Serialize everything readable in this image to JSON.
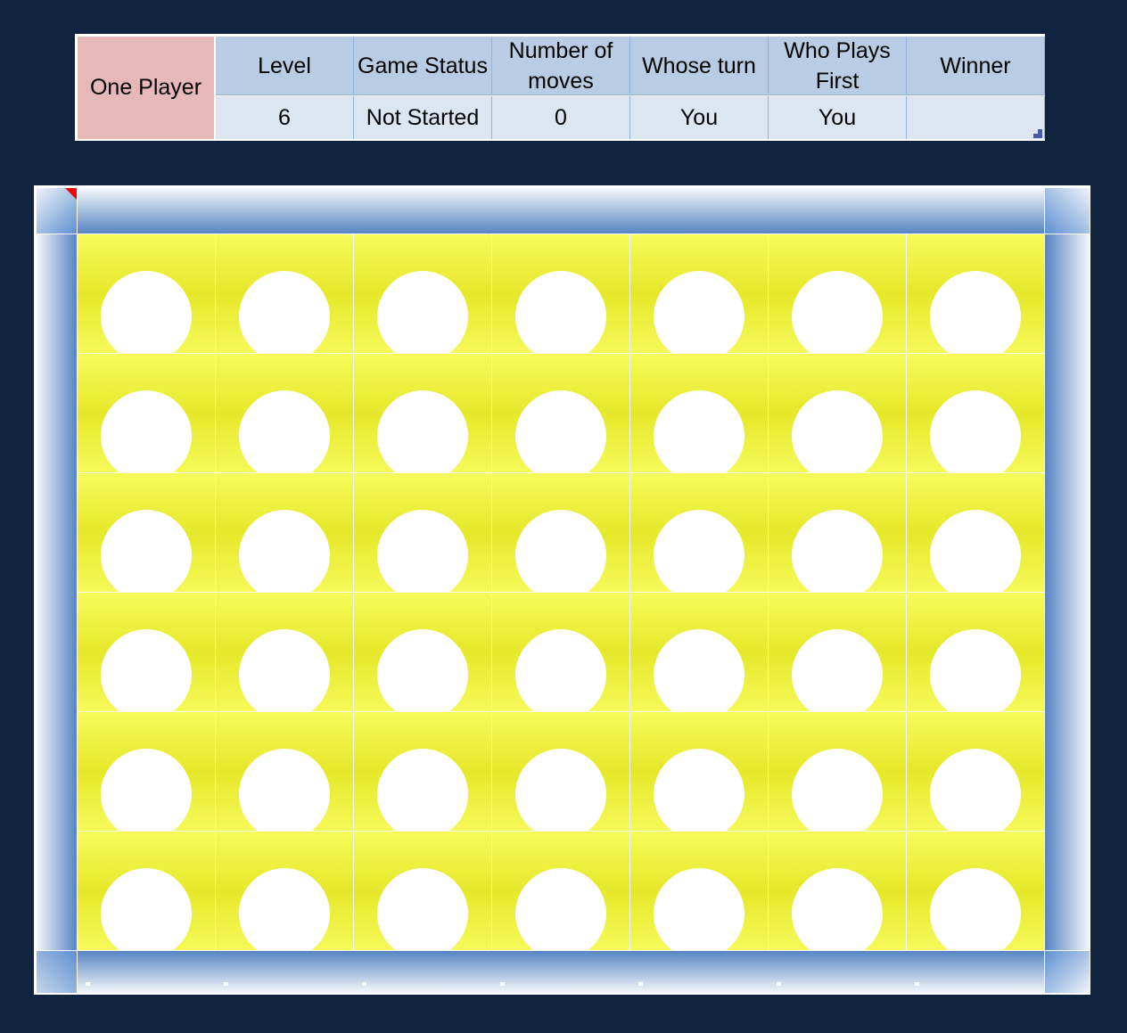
{
  "info": {
    "mode": "One Player",
    "headers": [
      "Level",
      "Game Status",
      "Number of moves",
      "Whose turn",
      "Who Plays First",
      "Winner"
    ],
    "values": [
      "6",
      "Not Started",
      "0",
      "You",
      "You",
      ""
    ]
  },
  "board": {
    "rows": 6,
    "columns": 7,
    "cells": [
      [
        "empty",
        "empty",
        "empty",
        "empty",
        "empty",
        "empty",
        "empty"
      ],
      [
        "empty",
        "empty",
        "empty",
        "empty",
        "empty",
        "empty",
        "empty"
      ],
      [
        "empty",
        "empty",
        "empty",
        "empty",
        "empty",
        "empty",
        "empty"
      ],
      [
        "empty",
        "empty",
        "empty",
        "empty",
        "empty",
        "empty",
        "empty"
      ],
      [
        "empty",
        "empty",
        "empty",
        "empty",
        "empty",
        "empty",
        "empty"
      ],
      [
        "empty",
        "empty",
        "empty",
        "empty",
        "empty",
        "empty",
        "empty"
      ]
    ],
    "colors": {
      "board": "#eef03a",
      "hole": "#ffffff",
      "frame": "#5685c2",
      "background": "#10233f"
    }
  }
}
